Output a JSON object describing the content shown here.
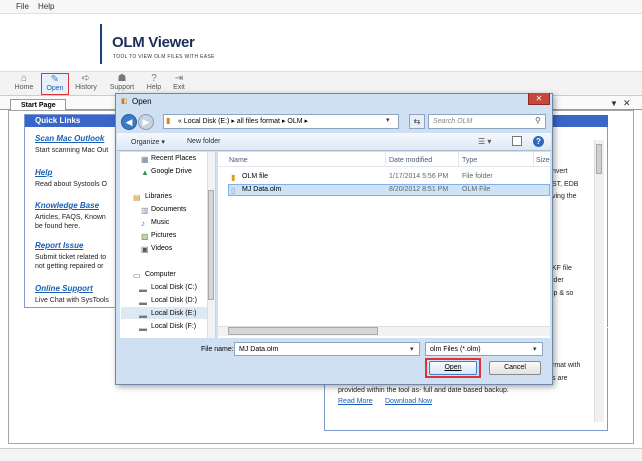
{
  "menu": {
    "file": "File",
    "help": "Help"
  },
  "banner": {
    "logo": "OLM Viewer",
    "tagline": "TOOL TO VIEW OLM FILES WITH EASE"
  },
  "toolbar": {
    "home": "Home",
    "open": "Open",
    "history": "History",
    "support": "Support",
    "help": "Help",
    "exit": "Exit"
  },
  "tab": {
    "label": "Start Page",
    "pin": "▼",
    "close": "✕"
  },
  "quick_links": {
    "title": "Quick Links",
    "items": [
      {
        "title": "Scan Mac Outlook",
        "desc": [
          "Start scanning Mac Out"
        ]
      },
      {
        "title": "Help",
        "desc": [
          "Read about Systools O"
        ]
      },
      {
        "title": "Knowledge Base",
        "desc": [
          "Articles, FAQS, Known",
          "be found here."
        ]
      },
      {
        "title": "Report Issue",
        "desc": [
          "Submit ticket related to",
          "not getting repaired or"
        ]
      },
      {
        "title": "Online Support",
        "desc": [
          "Live Chat with SysTools"
        ]
      }
    ]
  },
  "right_panel": {
    "lines": [
      "nvert",
      "ST, EDB",
      "ving the",
      "KF file",
      "lder",
      "ip & so",
      "rmat with",
      "s are"
    ],
    "bottom_line": "provided within the tool as- full and date based backup.",
    "read_more": "Read More",
    "download_now": "Download Now"
  },
  "dialog": {
    "title": "Open",
    "close": "✕",
    "path": [
      "«",
      "Local Disk (E:)",
      "▸",
      "all files format",
      "▸",
      "OLM",
      "▸"
    ],
    "search_placeholder": "Search OLM",
    "organize": "Organize ▾",
    "new_folder": "New folder",
    "help": "?",
    "nav": {
      "recent_places": "Recent Places",
      "google_drive": "Google Drive",
      "libraries": "Libraries",
      "documents": "Documents",
      "music": "Music",
      "pictures": "Pictures",
      "videos": "Videos",
      "computer": "Computer",
      "drives": [
        "Local Disk (C:)",
        "Local Disk (D:)",
        "Local Disk (E:)",
        "Local Disk (F:)"
      ]
    },
    "columns": {
      "name": "Name",
      "date": "Date modified",
      "type": "Type",
      "size": "Size"
    },
    "files": [
      {
        "name": "OLM file",
        "date": "1/17/2014 5:56 PM",
        "type": "File folder"
      },
      {
        "name": "MJ Data.olm",
        "date": "8/20/2012 8:51 PM",
        "type": "OLM File"
      }
    ],
    "file_name_label": "File name:",
    "file_name_value": "MJ Data.olm",
    "file_type": "olm Files (*.olm)",
    "open_button": "Open",
    "cancel_button": "Cancel"
  },
  "colors": {
    "accent": "#3a66c9",
    "link": "#1a5fb4",
    "highlight": "#dd3333"
  }
}
